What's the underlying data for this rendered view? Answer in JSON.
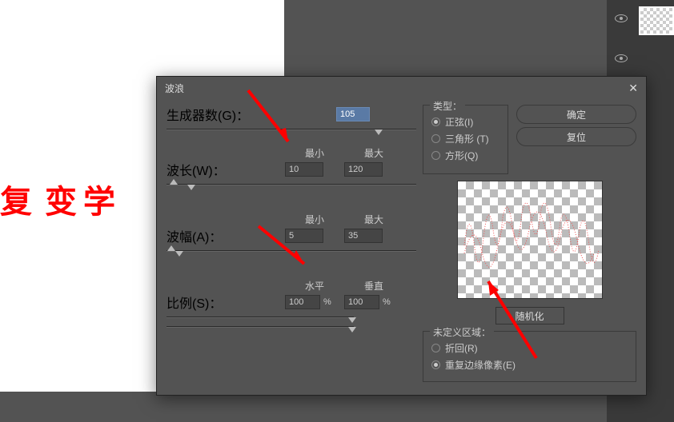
{
  "canvas_text_1": "复",
  "canvas_text_2": "变学",
  "dialog": {
    "title": "波浪",
    "generators_label": "生成器数(G)：",
    "generators_value": "105",
    "wavelength_label": "波长(W)：",
    "min_label": "最小",
    "max_label": "最大",
    "wavelength_min": "10",
    "wavelength_max": "120",
    "amplitude_label": "波幅(A)：",
    "amplitude_min": "5",
    "amplitude_max": "35",
    "scale_label": "比例(S)：",
    "horiz_label": "水平",
    "vert_label": "垂直",
    "horiz_value": "100",
    "vert_value": "100",
    "percent": "%",
    "type": {
      "group_label": "类型：",
      "sine": "正弦(I)",
      "triangle": "三角形 (T)",
      "square": "方形(Q)"
    },
    "ok": "确定",
    "reset": "复位",
    "randomize": "随机化",
    "undef": {
      "group_label": "未定义区域：",
      "wrap": "折回(R)",
      "repeat": "重复边缘像素(E)"
    }
  }
}
